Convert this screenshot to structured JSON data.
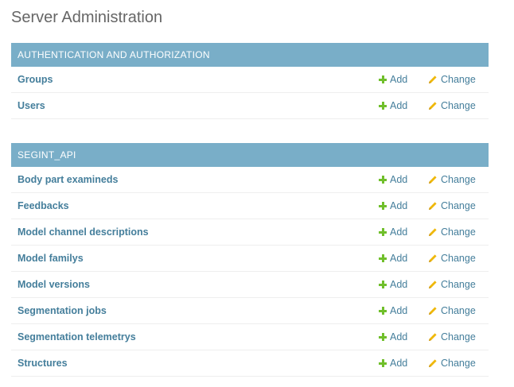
{
  "page": {
    "title": "Server Administration"
  },
  "colors": {
    "caption_bg": "#79aec8",
    "link": "#447e9b",
    "add_icon": "#70bf2b",
    "change_icon": "#efb80b"
  },
  "modules": [
    {
      "caption": "AUTHENTICATION AND AUTHORIZATION",
      "models": [
        {
          "name": "Groups",
          "add_label": "Add",
          "change_label": "Change"
        },
        {
          "name": "Users",
          "add_label": "Add",
          "change_label": "Change"
        }
      ]
    },
    {
      "caption": "SEGINT_API",
      "models": [
        {
          "name": "Body part examineds",
          "add_label": "Add",
          "change_label": "Change"
        },
        {
          "name": "Feedbacks",
          "add_label": "Add",
          "change_label": "Change"
        },
        {
          "name": "Model channel descriptions",
          "add_label": "Add",
          "change_label": "Change"
        },
        {
          "name": "Model familys",
          "add_label": "Add",
          "change_label": "Change"
        },
        {
          "name": "Model versions",
          "add_label": "Add",
          "change_label": "Change"
        },
        {
          "name": "Segmentation jobs",
          "add_label": "Add",
          "change_label": "Change"
        },
        {
          "name": "Segmentation telemetrys",
          "add_label": "Add",
          "change_label": "Change"
        },
        {
          "name": "Structures",
          "add_label": "Add",
          "change_label": "Change"
        }
      ]
    }
  ]
}
